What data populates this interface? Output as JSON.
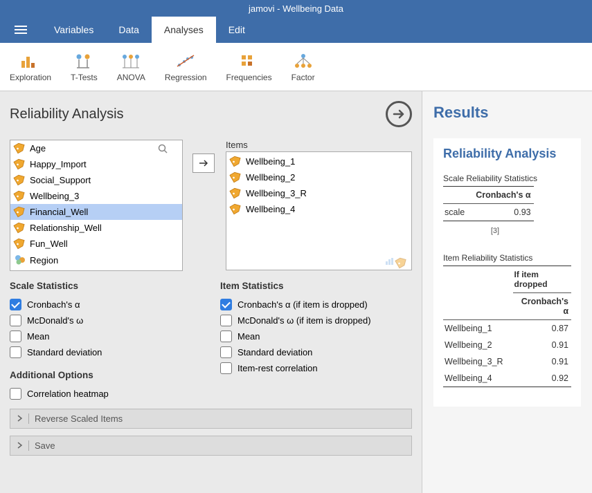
{
  "title": "jamovi - Wellbeing Data",
  "menu_tabs": [
    "Variables",
    "Data",
    "Analyses",
    "Edit"
  ],
  "active_tab_index": 2,
  "ribbon": [
    {
      "label": "Exploration"
    },
    {
      "label": "T-Tests"
    },
    {
      "label": "ANOVA"
    },
    {
      "label": "Regression"
    },
    {
      "label": "Frequencies"
    },
    {
      "label": "Factor"
    }
  ],
  "panel_title": "Reliability Analysis",
  "variables": [
    {
      "name": "Age",
      "selected": false,
      "type": "cont"
    },
    {
      "name": "Happy_Import",
      "selected": false,
      "type": "cont"
    },
    {
      "name": "Social_Support",
      "selected": false,
      "type": "cont"
    },
    {
      "name": "Wellbeing_3",
      "selected": false,
      "type": "cont"
    },
    {
      "name": "Financial_Well",
      "selected": true,
      "type": "cont"
    },
    {
      "name": "Relationship_Well",
      "selected": false,
      "type": "cont"
    },
    {
      "name": "Fun_Well",
      "selected": false,
      "type": "cont"
    },
    {
      "name": "Region",
      "selected": false,
      "type": "nom"
    }
  ],
  "items_label": "Items",
  "items": [
    "Wellbeing_1",
    "Wellbeing_2",
    "Wellbeing_3_R",
    "Wellbeing_4"
  ],
  "scale_stats_title": "Scale Statistics",
  "scale_stats": [
    {
      "label": "Cronbach's α",
      "checked": true
    },
    {
      "label": "McDonald's ω",
      "checked": false
    },
    {
      "label": "Mean",
      "checked": false
    },
    {
      "label": "Standard deviation",
      "checked": false
    }
  ],
  "item_stats_title": "Item Statistics",
  "item_stats": [
    {
      "label": "Cronbach's α (if item is dropped)",
      "checked": true
    },
    {
      "label": "McDonald's ω (if item is dropped)",
      "checked": false
    },
    {
      "label": "Mean",
      "checked": false
    },
    {
      "label": "Standard deviation",
      "checked": false
    },
    {
      "label": "Item-rest correlation",
      "checked": false
    }
  ],
  "additional_title": "Additional Options",
  "additional": [
    {
      "label": "Correlation heatmap",
      "checked": false
    }
  ],
  "collapsibles": [
    "Reverse Scaled Items",
    "Save"
  ],
  "results": {
    "title": "Results",
    "section": "Reliability Analysis",
    "scale_table_title": "Scale Reliability Statistics",
    "scale_col": "Cronbach's α",
    "scale_row_label": "scale",
    "scale_value": "0.93",
    "scale_footnote": "[3]",
    "item_table_title": "Item Reliability Statistics",
    "item_super": "If item dropped",
    "item_col": "Cronbach's α",
    "item_rows": [
      {
        "name": "Wellbeing_1",
        "value": "0.87"
      },
      {
        "name": "Wellbeing_2",
        "value": "0.91"
      },
      {
        "name": "Wellbeing_3_R",
        "value": "0.91"
      },
      {
        "name": "Wellbeing_4",
        "value": "0.92"
      }
    ]
  },
  "chart_data": {
    "type": "table",
    "title": "Item Reliability Statistics — Cronbach's α if item dropped",
    "categories": [
      "Wellbeing_1",
      "Wellbeing_2",
      "Wellbeing_3_R",
      "Wellbeing_4"
    ],
    "values": [
      0.87,
      0.91,
      0.91,
      0.92
    ]
  }
}
